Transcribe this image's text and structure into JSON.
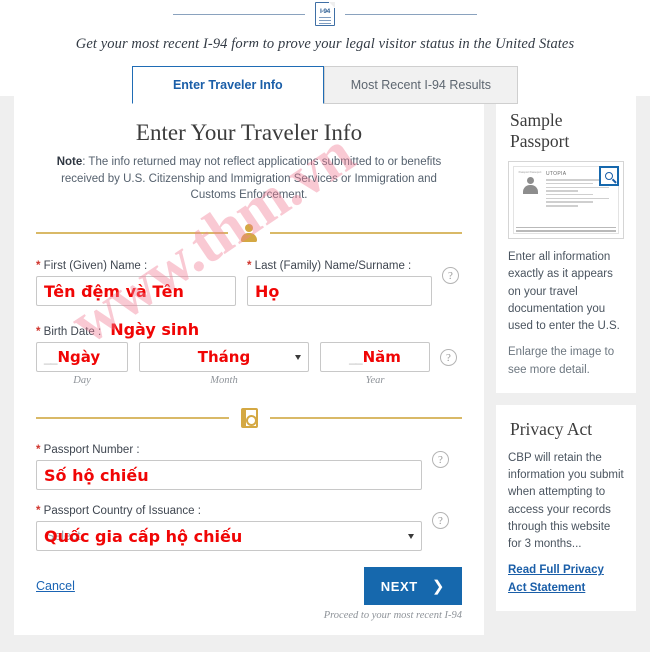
{
  "header": {
    "logo_icon": "i94-document-icon",
    "logo_text": "I-94",
    "tagline": "Get your most recent I-94 form to prove your legal visitor status in the United States"
  },
  "tabs": [
    {
      "label": "Enter Traveler Info",
      "active": true
    },
    {
      "label": "Most Recent I-94 Results",
      "active": false
    }
  ],
  "form": {
    "title": "Enter Your Traveler Info",
    "note_label": "Note",
    "note_body": ": The info returned may not reflect applications submitted to or benefits received by U.S. Citizenship and Immigration Services or Immigration and Customs Enforcement.",
    "divider_person_icon": "person-icon",
    "divider_passport_icon": "passport-icon",
    "help_icon": "question-mark-icon",
    "first_name": {
      "label_required": "*",
      "label": " First (Given) Name :",
      "value": "",
      "annotation": "Tên đệm và Tên"
    },
    "last_name": {
      "label_required": "*",
      "label": " Last (Family) Name/Surname :",
      "value": "",
      "annotation": "Họ"
    },
    "birth_date": {
      "label_required": "*",
      "label": " Birth Date :",
      "annotation": "Ngày sinh",
      "day": {
        "placeholder": "__",
        "sublabel": "Day",
        "annotation": "Ngày"
      },
      "month": {
        "placeholder": "",
        "sublabel": "Month",
        "annotation": "Tháng",
        "caret_icon": "chevron-down-icon"
      },
      "year": {
        "placeholder": "__",
        "sublabel": "Year",
        "annotation": "Năm"
      }
    },
    "passport_number": {
      "label_required": "*",
      "label": " Passport Number :",
      "value": "",
      "annotation": "Số hộ chiếu"
    },
    "passport_country": {
      "label_required": "*",
      "label": " Passport Country of Issuance :",
      "value": "Select",
      "annotation": "Quốc gia cấp hộ chiếu",
      "caret_icon": "chevron-down-icon"
    },
    "cancel_label": "Cancel",
    "next_label": "NEXT",
    "next_chevron": "chevron-right-icon",
    "proceed_text": "Proceed to your most recent I-94"
  },
  "sidebar": {
    "sample_passport": {
      "title": "Sample Passport",
      "zoom_icon": "magnifier-icon",
      "thumb_country": "UTOPIA",
      "thumb_photo_label": "Passport Passeport",
      "text_primary": "Enter all information exactly as it appears on your travel documentation you used to enter the U.S.",
      "text_secondary": "Enlarge the image to see more detail."
    },
    "privacy_act": {
      "title": "Privacy Act",
      "body": "CBP will retain the information you submit when attempting to access your records through this website for 3 months...",
      "link": "Read Full Privacy Act Statement"
    }
  },
  "watermark": {
    "text": "www.thm.vn"
  },
  "colors": {
    "accent_blue": "#1668ad",
    "gold_divider": "#d4a843",
    "annotation_red": "#f00505",
    "required_red": "#d0342c",
    "watermark_pink": "#f17e96"
  }
}
